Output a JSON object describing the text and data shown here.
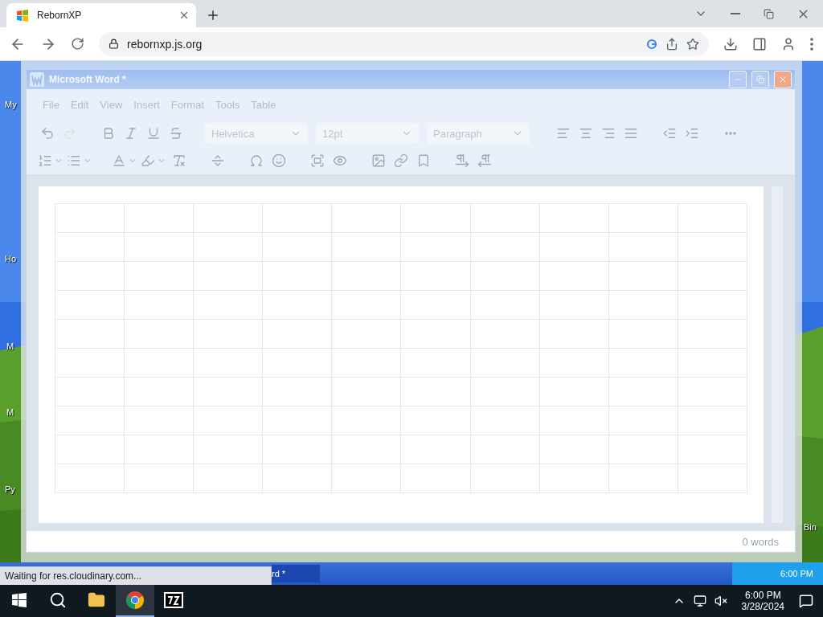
{
  "browser": {
    "tabs": [
      {
        "title": "RebornXP",
        "selected": true
      }
    ],
    "address": "rebornxp.js.org",
    "status": "Waiting for res.cloudinary.com..."
  },
  "desktop": {
    "icon_labels": [
      {
        "text": "My"
      },
      {
        "text": "Ho"
      },
      {
        "text": "M"
      },
      {
        "text": "M"
      },
      {
        "text": "Py"
      },
      {
        "text": "Bin"
      }
    ],
    "xp_taskbar": {
      "task": "rd *",
      "clock": "6:00 PM"
    }
  },
  "word": {
    "title": "Microsoft Word *",
    "menu": [
      "File",
      "Edit",
      "View",
      "Insert",
      "Format",
      "Tools",
      "Table"
    ],
    "toolbar_rows": [
      [
        {
          "kind": "button",
          "disabled": false
        },
        {
          "kind": "button",
          "disabled": true
        },
        {
          "kind": "gap"
        },
        {
          "kind": "button",
          "disabled": false
        },
        {
          "kind": "button",
          "disabled": false
        },
        {
          "kind": "button",
          "disabled": false
        },
        {
          "kind": "button",
          "disabled": false
        },
        {
          "kind": "gap"
        },
        {
          "kind": "select",
          "value": "Helvetica"
        },
        {
          "kind": "select",
          "value": "12pt"
        },
        {
          "kind": "select",
          "value": "Paragraph"
        },
        {
          "kind": "gap"
        },
        {
          "kind": "button",
          "disabled": false
        },
        {
          "kind": "button",
          "disabled": false
        },
        {
          "kind": "button",
          "disabled": false
        },
        {
          "kind": "button",
          "disabled": false
        },
        {
          "kind": "gap"
        },
        {
          "kind": "button",
          "disabled": false
        },
        {
          "kind": "button",
          "disabled": false
        },
        {
          "kind": "gap"
        },
        {
          "kind": "button",
          "disabled": false
        }
      ],
      [
        {
          "kind": "split",
          "disabled": false
        },
        {
          "kind": "split",
          "disabled": false
        },
        {
          "kind": "gap"
        },
        {
          "kind": "split",
          "disabled": false
        },
        {
          "kind": "split",
          "disabled": false
        },
        {
          "kind": "button",
          "disabled": false
        },
        {
          "kind": "gap"
        },
        {
          "kind": "button",
          "disabled": false
        },
        {
          "kind": "gap"
        },
        {
          "kind": "button",
          "disabled": false
        },
        {
          "kind": "button",
          "disabled": false
        },
        {
          "kind": "gap"
        },
        {
          "kind": "button",
          "disabled": false
        },
        {
          "kind": "button",
          "disabled": false
        },
        {
          "kind": "gap"
        },
        {
          "kind": "button",
          "disabled": false
        },
        {
          "kind": "button",
          "disabled": false
        },
        {
          "kind": "button",
          "disabled": false
        },
        {
          "kind": "gap"
        },
        {
          "kind": "button",
          "disabled": false
        },
        {
          "kind": "button",
          "disabled": false
        }
      ]
    ],
    "table": {
      "rows": [
        [
          {
            "kind": "empty"
          },
          {
            "kind": "empty"
          },
          {
            "kind": "empty"
          },
          {
            "kind": "empty"
          },
          {
            "kind": "empty"
          },
          {
            "kind": "empty"
          },
          {
            "kind": "empty"
          },
          {
            "kind": "empty"
          },
          {
            "kind": "empty"
          },
          {
            "kind": "empty"
          }
        ],
        [
          {
            "kind": "empty"
          },
          {
            "kind": "empty"
          },
          {
            "kind": "empty"
          },
          {
            "kind": "empty"
          },
          {
            "kind": "empty"
          },
          {
            "kind": "empty"
          },
          {
            "kind": "empty"
          },
          {
            "kind": "empty"
          },
          {
            "kind": "empty"
          },
          {
            "kind": "empty"
          }
        ],
        [
          {
            "kind": "empty"
          },
          {
            "kind": "empty"
          },
          {
            "kind": "empty"
          },
          {
            "kind": "empty"
          },
          {
            "kind": "empty"
          },
          {
            "kind": "empty"
          },
          {
            "kind": "empty"
          },
          {
            "kind": "empty"
          },
          {
            "kind": "empty"
          },
          {
            "kind": "empty"
          }
        ],
        [
          {
            "kind": "empty"
          },
          {
            "kind": "empty"
          },
          {
            "kind": "empty"
          },
          {
            "kind": "empty"
          },
          {
            "kind": "empty"
          },
          {
            "kind": "empty"
          },
          {
            "kind": "empty"
          },
          {
            "kind": "empty"
          },
          {
            "kind": "empty"
          },
          {
            "kind": "empty"
          }
        ],
        [
          {
            "kind": "empty"
          },
          {
            "kind": "empty"
          },
          {
            "kind": "empty"
          },
          {
            "kind": "empty"
          },
          {
            "kind": "empty"
          },
          {
            "kind": "empty"
          },
          {
            "kind": "empty"
          },
          {
            "kind": "empty"
          },
          {
            "kind": "empty"
          },
          {
            "kind": "empty"
          }
        ],
        [
          {
            "kind": "empty"
          },
          {
            "kind": "empty"
          },
          {
            "kind": "empty"
          },
          {
            "kind": "empty"
          },
          {
            "kind": "empty"
          },
          {
            "kind": "empty"
          },
          {
            "kind": "empty"
          },
          {
            "kind": "empty"
          },
          {
            "kind": "empty"
          },
          {
            "kind": "empty"
          }
        ],
        [
          {
            "kind": "empty"
          },
          {
            "kind": "empty"
          },
          {
            "kind": "empty"
          },
          {
            "kind": "empty"
          },
          {
            "kind": "empty"
          },
          {
            "kind": "empty"
          },
          {
            "kind": "empty"
          },
          {
            "kind": "empty"
          },
          {
            "kind": "empty"
          },
          {
            "kind": "empty"
          }
        ],
        [
          {
            "kind": "empty"
          },
          {
            "kind": "empty"
          },
          {
            "kind": "empty"
          },
          {
            "kind": "empty"
          },
          {
            "kind": "empty"
          },
          {
            "kind": "empty"
          },
          {
            "kind": "empty"
          },
          {
            "kind": "empty"
          },
          {
            "kind": "empty"
          },
          {
            "kind": "empty"
          }
        ],
        [
          {
            "kind": "empty"
          },
          {
            "kind": "empty"
          },
          {
            "kind": "empty"
          },
          {
            "kind": "empty"
          },
          {
            "kind": "empty"
          },
          {
            "kind": "empty"
          },
          {
            "kind": "empty"
          },
          {
            "kind": "empty"
          },
          {
            "kind": "empty"
          },
          {
            "kind": "empty"
          }
        ],
        [
          {
            "kind": "empty"
          },
          {
            "kind": "empty"
          },
          {
            "kind": "empty"
          },
          {
            "kind": "empty"
          },
          {
            "kind": "empty"
          },
          {
            "kind": "empty"
          },
          {
            "kind": "empty"
          },
          {
            "kind": "empty"
          },
          {
            "kind": "empty"
          },
          {
            "kind": "empty"
          }
        ]
      ]
    },
    "word_count": "0 words"
  },
  "taskbar": {
    "apps": [
      {
        "selected": false
      },
      {
        "selected": true
      },
      {
        "selected": false
      }
    ],
    "time": "6:00 PM",
    "date": "3/28/2024"
  }
}
